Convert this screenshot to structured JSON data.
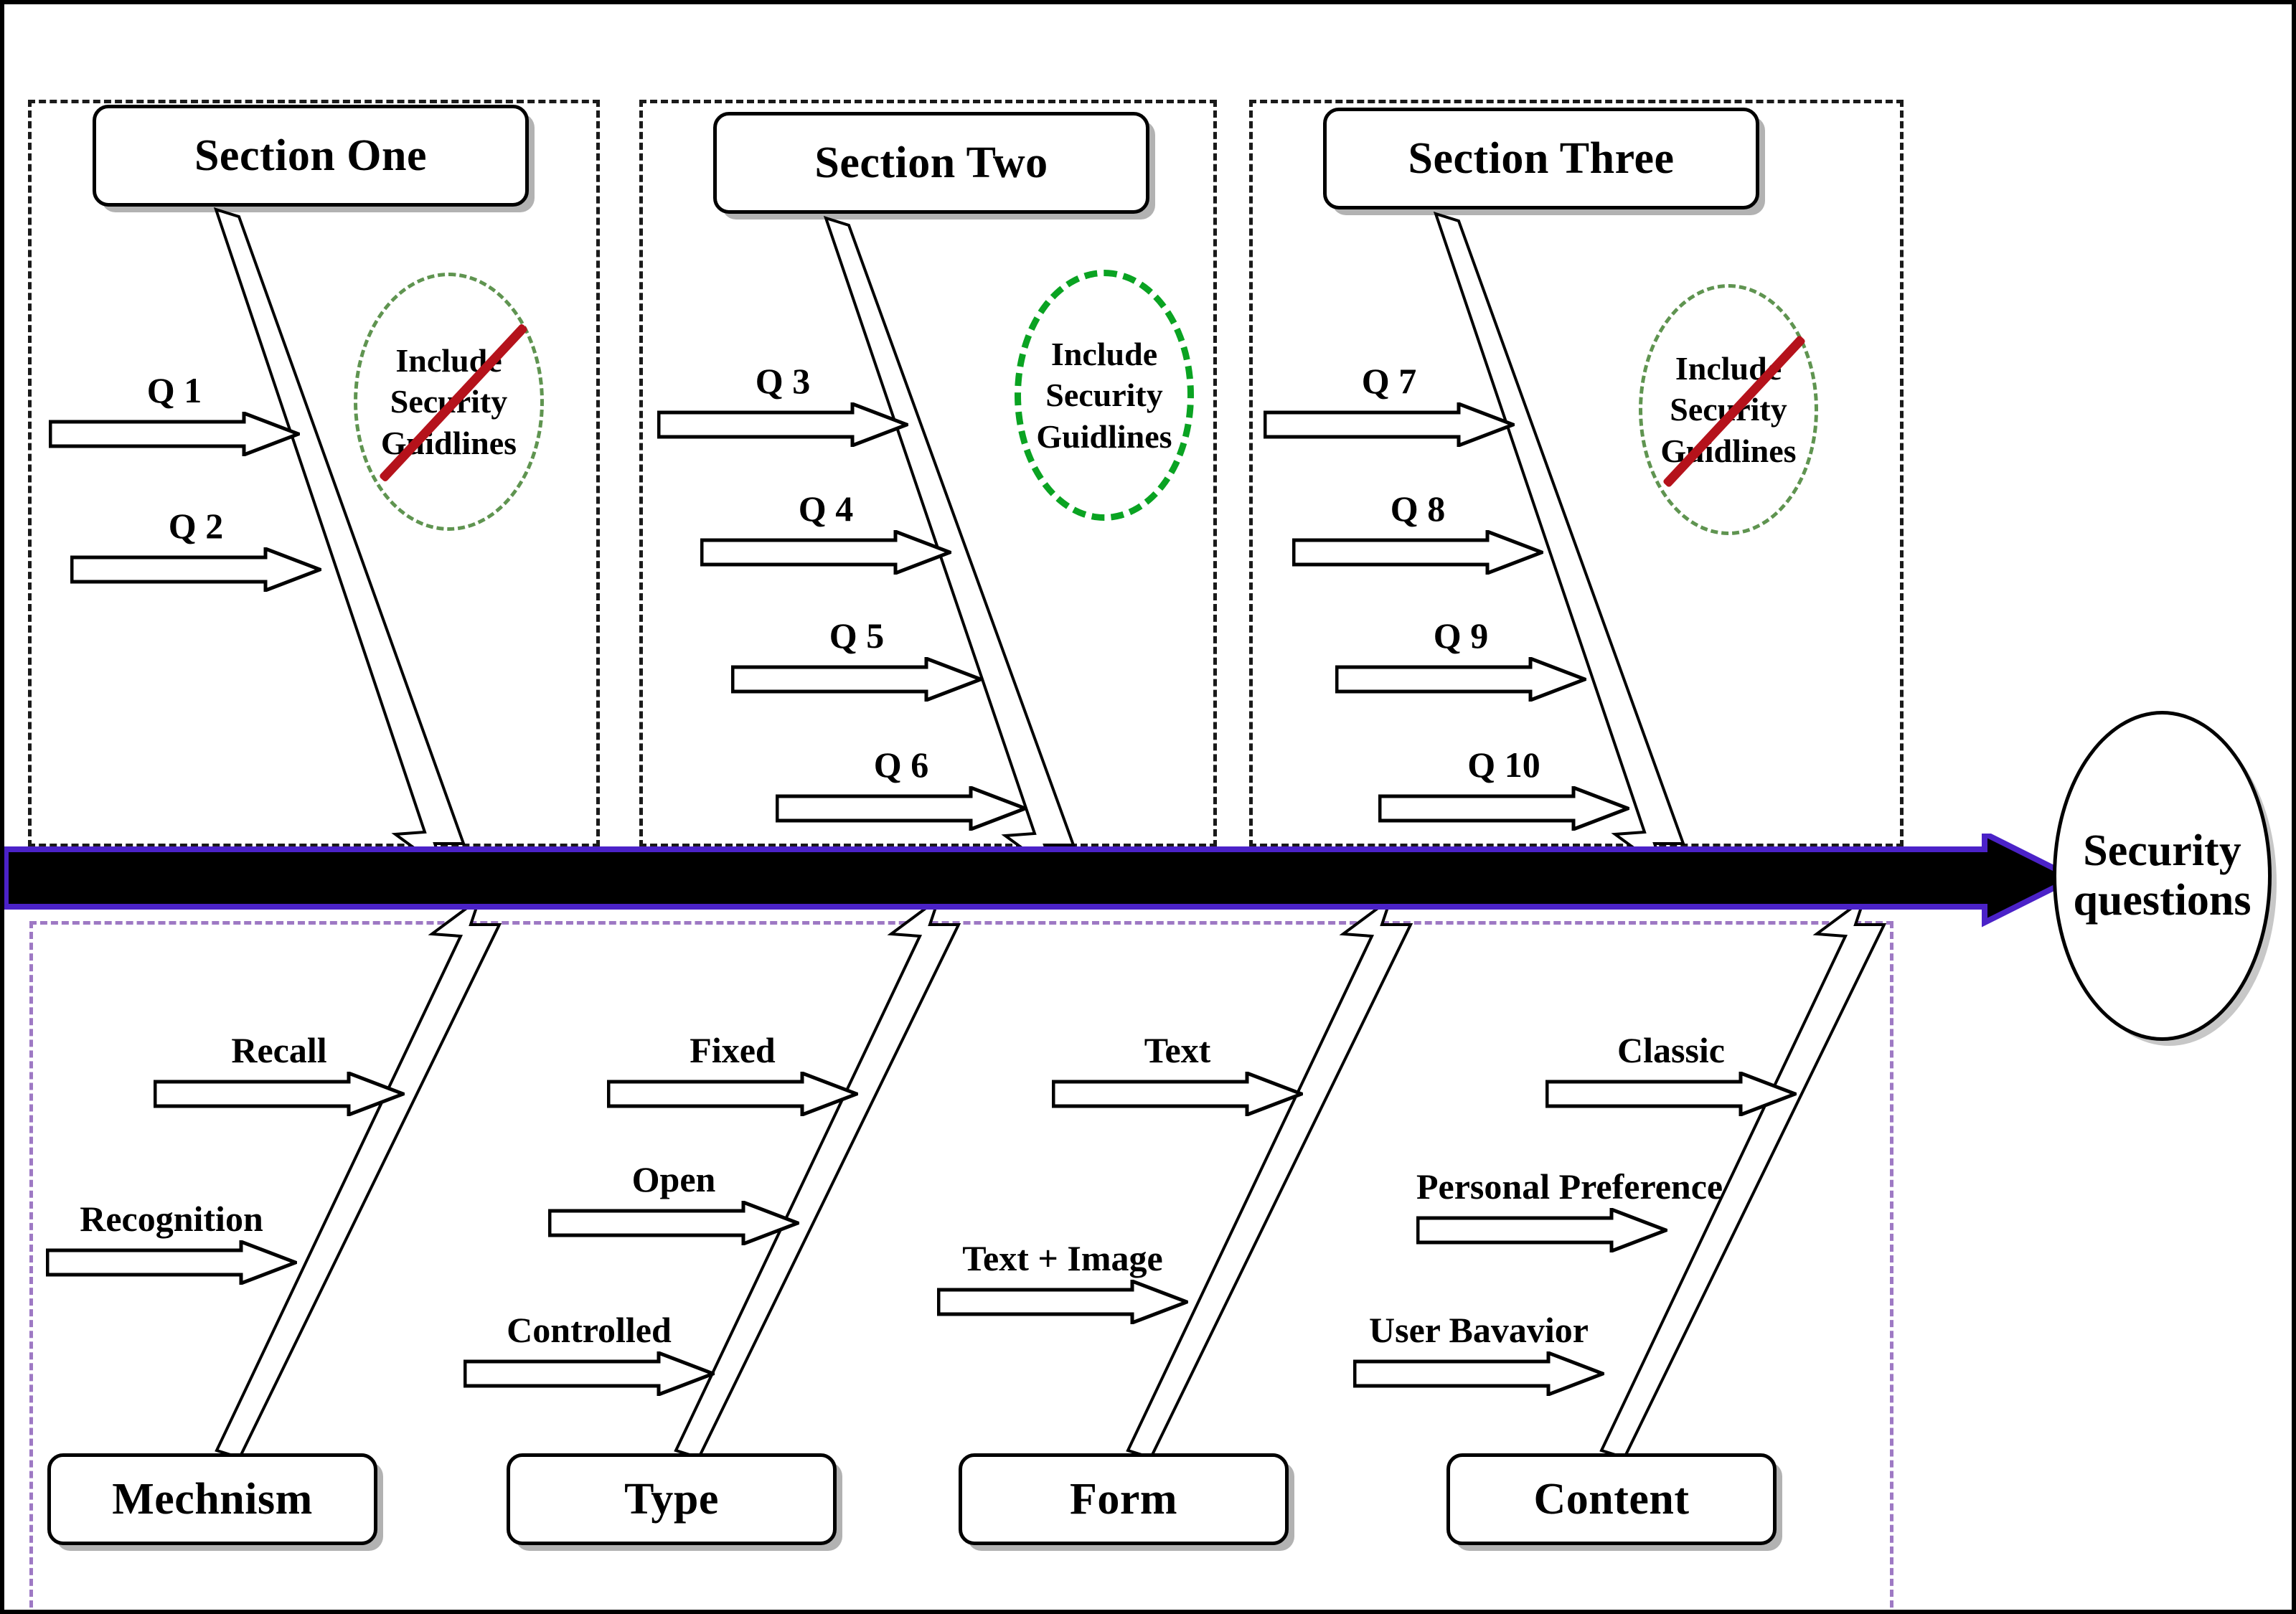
{
  "diagram": {
    "type": "fishbone-ishikawa",
    "effect": {
      "line1": "Security",
      "line2": "questions"
    },
    "spine_color": "#000000",
    "spine_outline_color": "#4b22c8",
    "top_region_border_color": "#1a1a1a",
    "bottom_region_border_color": "#9e79c4",
    "note_ellipse_color_thin": "#5f9450",
    "note_ellipse_color_thick": "#0aa322",
    "strike_color": "#b5121b"
  },
  "top_categories": [
    {
      "id": "section-one",
      "label": "Section One",
      "causes": [
        "Q 1",
        "Q 2"
      ],
      "note": {
        "line1": "Include",
        "line2": "Security",
        "line3": "Guidlines",
        "style": "thin",
        "struck": true
      }
    },
    {
      "id": "section-two",
      "label": "Section Two",
      "causes": [
        "Q 3",
        "Q 4",
        "Q 5",
        "Q 6"
      ],
      "note": {
        "line1": "Include",
        "line2": "Security",
        "line3": "Guidlines",
        "style": "thick",
        "struck": false
      }
    },
    {
      "id": "section-three",
      "label": "Section Three",
      "causes": [
        "Q 7",
        "Q 8",
        "Q 9",
        "Q 10"
      ],
      "note": {
        "line1": "Include",
        "line2": "Security",
        "line3": "Guidlines",
        "style": "thin",
        "struck": true
      }
    }
  ],
  "bottom_categories": [
    {
      "id": "mechnism",
      "label": "Mechnism",
      "causes": [
        "Recall",
        "Recognition"
      ]
    },
    {
      "id": "type",
      "label": "Type",
      "causes": [
        "Fixed",
        "Open",
        "Controlled"
      ]
    },
    {
      "id": "form",
      "label": "Form",
      "causes": [
        "Text",
        "Text + Image"
      ]
    },
    {
      "id": "content",
      "label": "Content",
      "causes": [
        "Classic",
        "Personal Preference",
        "User Bavavior"
      ]
    }
  ]
}
